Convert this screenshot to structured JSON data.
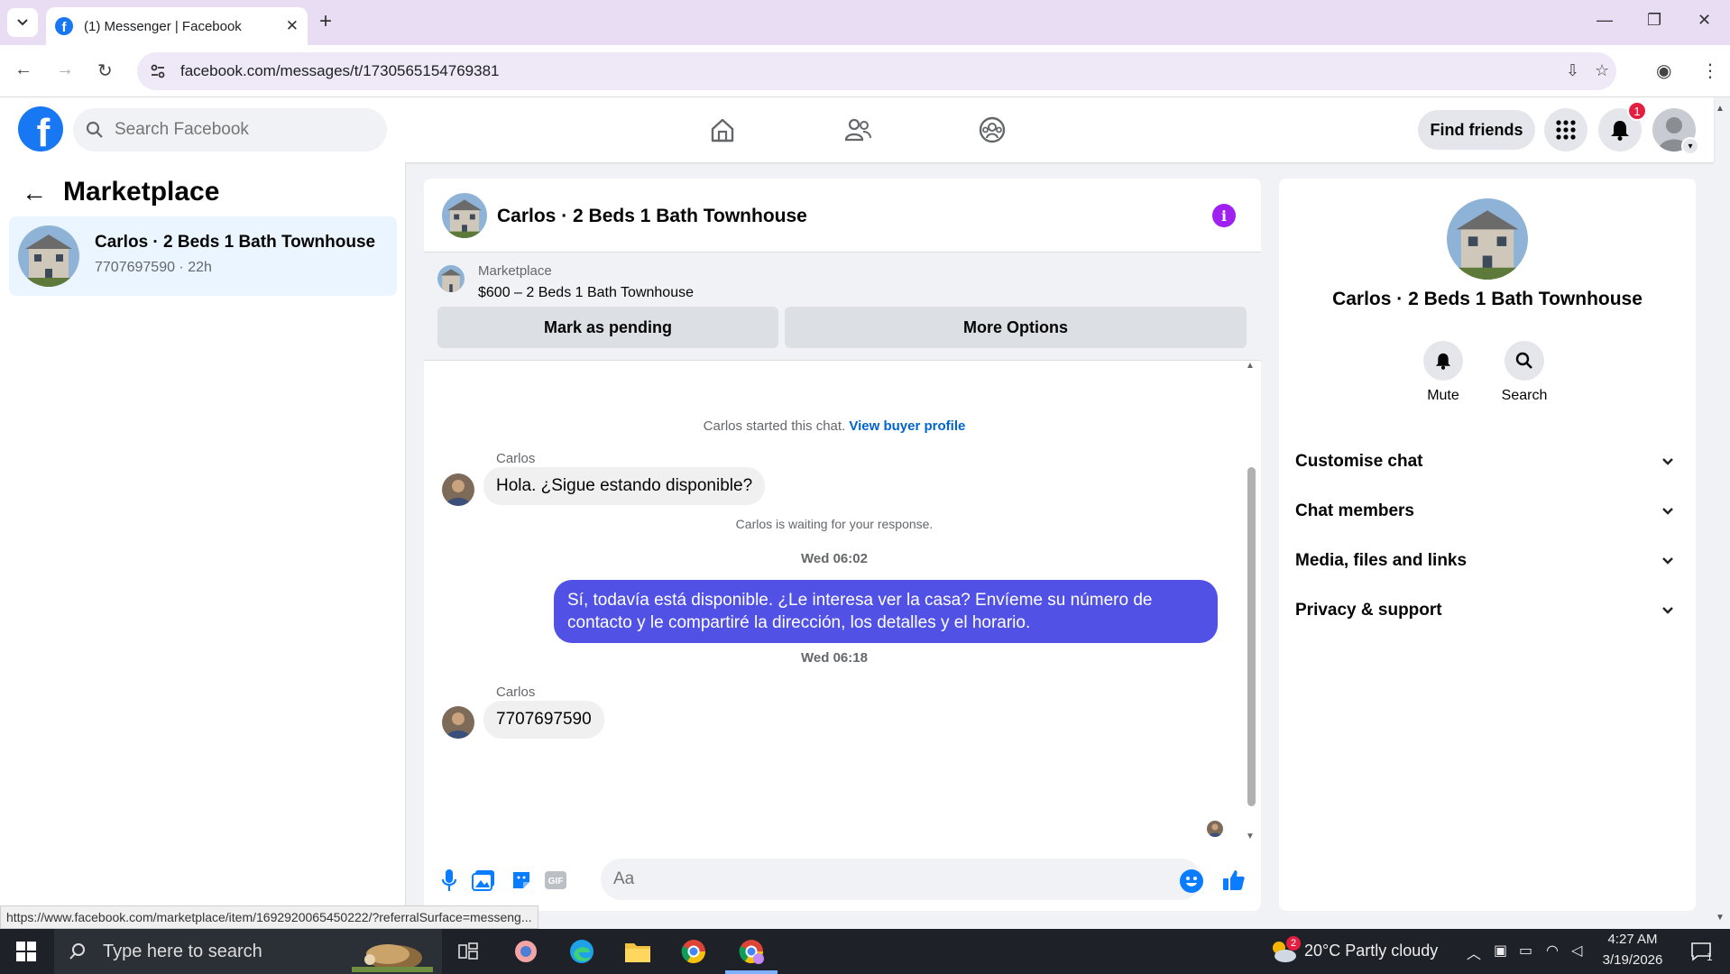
{
  "browser": {
    "tab_title": "(1) Messenger | Facebook",
    "url": "facebook.com/messages/t/1730565154769381",
    "status_link": "https://www.facebook.com/marketplace/item/1692920065450222/?referralSurface=messeng..."
  },
  "fb_header": {
    "search_placeholder": "Search Facebook",
    "find_friends_label": "Find friends",
    "notification_count": "1",
    "nav_icons": [
      "home-icon",
      "friends-icon",
      "groups-icon"
    ]
  },
  "sidebar": {
    "title": "Marketplace",
    "conversations": [
      {
        "name": "Carlos · 2 Beds 1 Bath Townhouse",
        "meta": "7707697590 · 22h"
      }
    ]
  },
  "chat": {
    "title": "Carlos · 2 Beds 1 Bath Townhouse",
    "listing": {
      "source": "Marketplace",
      "price_title": "$600 – 2 Beds 1 Bath Townhouse",
      "mark_pending_label": "Mark as pending",
      "more_options_label": "More Options"
    },
    "started_text": "Carlos started this chat.",
    "view_buyer_profile": "View buyer profile",
    "messages": [
      {
        "sender": "Carlos",
        "text": "Hola. ¿Sigue estando disponible?",
        "direction": "in"
      },
      {
        "text": "Sí, todavía está disponible. ¿Le interesa ver la casa? Envíeme su número de contacto y le compartiré la dirección, los detalles y el horario.",
        "direction": "out"
      },
      {
        "sender": "Carlos",
        "text": "7707697590",
        "direction": "in"
      }
    ],
    "waiting_text": "Carlos is waiting for your response.",
    "timestamps": [
      "Wed 06:02",
      "Wed 06:18"
    ],
    "composer_placeholder": "Aa"
  },
  "info_panel": {
    "name": "Carlos · 2 Beds 1 Bath Townhouse",
    "actions": [
      {
        "label": "Mute",
        "icon": "bell-icon"
      },
      {
        "label": "Search",
        "icon": "search-icon"
      }
    ],
    "sections": [
      "Customise chat",
      "Chat members",
      "Media, files and links",
      "Privacy & support"
    ]
  },
  "taskbar": {
    "search_placeholder": "Type here to search",
    "weather": "20°C  Partly cloudy",
    "weather_badge": "2",
    "time": "4:27 AM",
    "date": "3/19/2026",
    "notification_count": "1"
  },
  "colors": {
    "fb_blue": "#1877f2",
    "outgoing_bubble": "#5151e6",
    "link": "#0064d1",
    "info_icon": "#a020f0",
    "notif_red": "#e41e3f"
  }
}
